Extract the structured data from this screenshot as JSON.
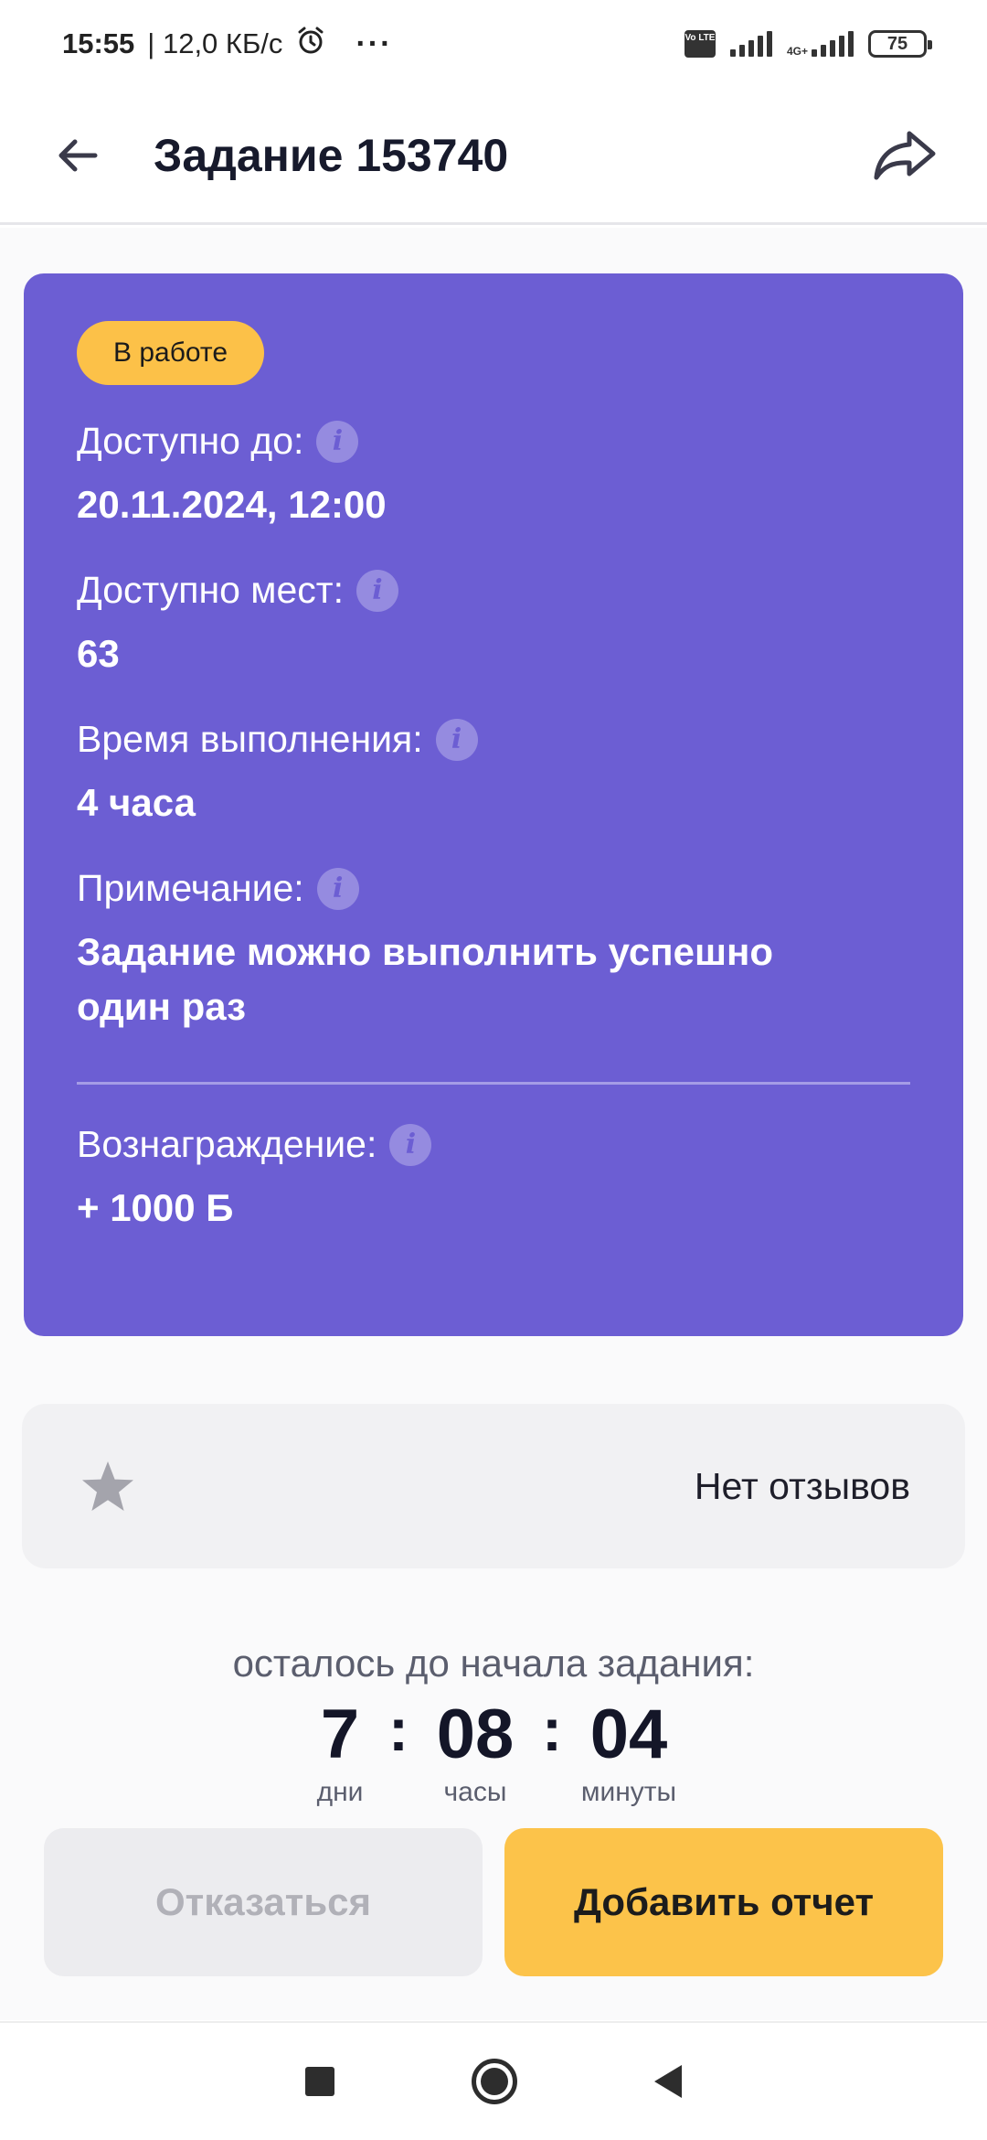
{
  "status_bar": {
    "time": "15:55",
    "speed": "| 12,0 КБ/с",
    "more": "···",
    "volte": "Vo LTE",
    "network": "4G+",
    "battery": "75"
  },
  "app_bar": {
    "title": "Задание 153740",
    "back_icon": "arrow-left-icon",
    "share_icon": "share-icon"
  },
  "task_card": {
    "background": "#6c5ed3",
    "status_badge": "В работе",
    "available_until": {
      "label": "Доступно до:",
      "value": "20.11.2024, 12:00"
    },
    "available_slots": {
      "label": "Доступно мест:",
      "value": "63"
    },
    "duration": {
      "label": "Время выполнения:",
      "value": "4 часа"
    },
    "note": {
      "label": "Примечание:",
      "value": "Задание можно выполнить успешно один раз"
    },
    "reward": {
      "label": "Вознаграждение:",
      "value": "+ 1000 Б"
    },
    "info_glyph": "i"
  },
  "reviews": {
    "icon": "star-icon",
    "text": "Нет отзывов"
  },
  "countdown": {
    "label": "осталось до начала задания:",
    "days": "7",
    "hours": "08",
    "minutes": "04",
    "separator": ":",
    "days_caption": "дни",
    "hours_caption": "часы",
    "minutes_caption": "минуты"
  },
  "actions": {
    "decline_label": "Отказаться",
    "report_label": "Добавить отчет",
    "accent": "#fcc34a"
  },
  "nav_bar": {
    "recents_icon": "square-icon",
    "home_icon": "circle-icon",
    "back_icon": "triangle-back-icon"
  }
}
